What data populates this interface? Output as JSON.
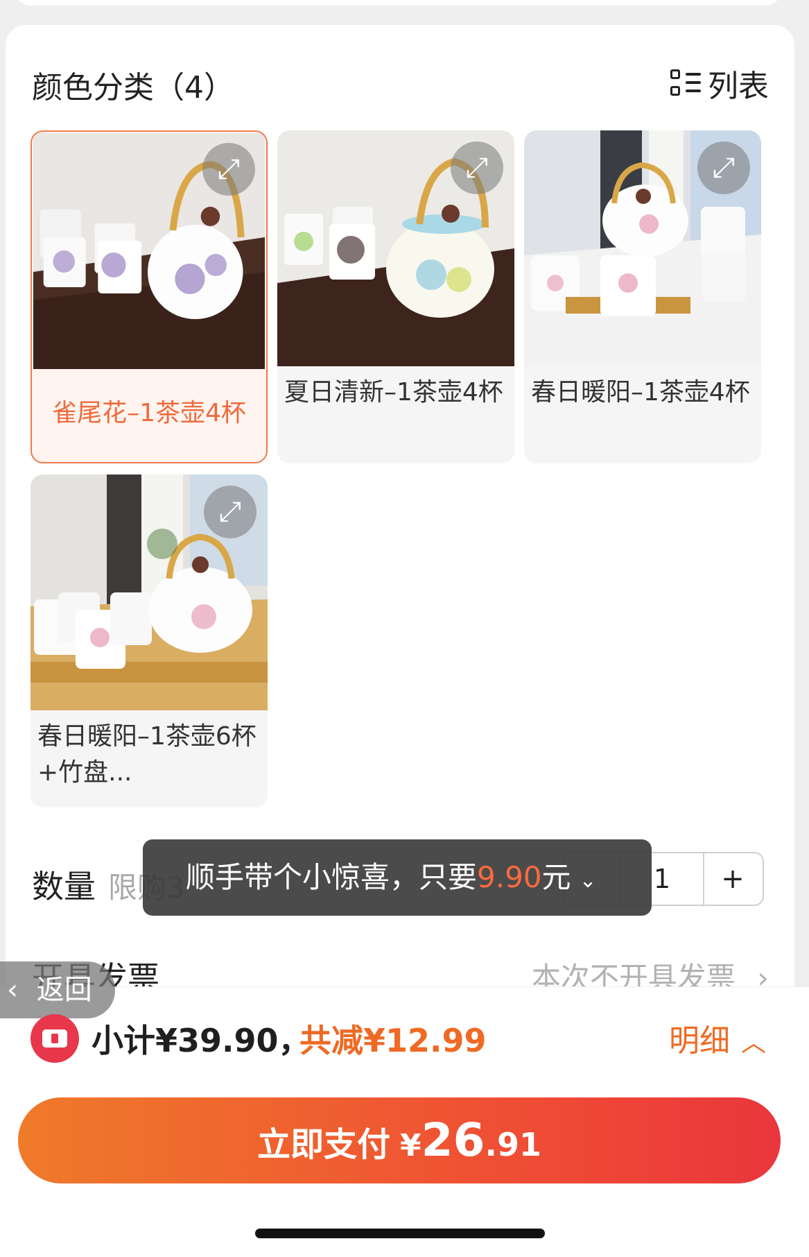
{
  "section": {
    "title": "颜色分类（4）",
    "view_toggle": "列表"
  },
  "skus": [
    {
      "label": "雀尾花–1茶壶4杯",
      "selected": true
    },
    {
      "label": "夏日清新–1茶壶4杯",
      "selected": false
    },
    {
      "label": "春日暖阳–1茶壶4杯",
      "selected": false
    },
    {
      "label": "春日暖阳–1茶壶6杯+竹盘...",
      "selected": false
    }
  ],
  "quantity": {
    "label": "数量",
    "limit": "限购3",
    "value": "1",
    "plus": "+"
  },
  "toast": {
    "text": "顺手带个小惊喜，只要",
    "price": "9.90",
    "suffix": "元"
  },
  "invoice": {
    "label": "开具发票",
    "value": "本次不开具发票"
  },
  "back": {
    "label": "返回"
  },
  "summary": {
    "subtotal": "小计¥39.90，",
    "discount": "共减¥12.99",
    "detail": "明细"
  },
  "pay": {
    "label": "立即支付",
    "currency": "¥",
    "integer": "26",
    "decimal": ".91"
  },
  "colors": {
    "accent": "#ee6a24",
    "selected_border": "#ee7a4d",
    "pay_start": "#ef7a2a",
    "pay_end": "#e9363c"
  },
  "icons": [
    "list-view-icon",
    "expand-icon",
    "chevron-down-icon",
    "chevron-left-icon",
    "chevron-right-icon",
    "chevron-up-icon",
    "coupon-icon"
  ]
}
